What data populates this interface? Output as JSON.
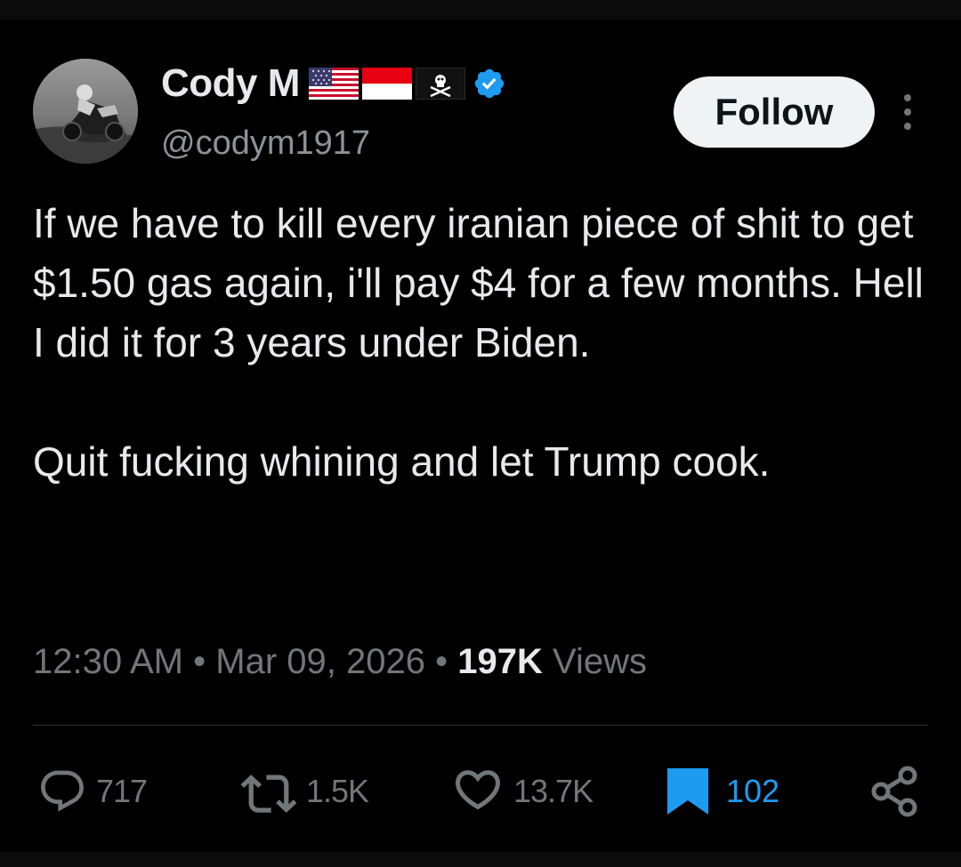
{
  "tweet": {
    "author": {
      "display_name": "Cody M",
      "handle": "@codym1917",
      "flags": [
        "us-flag-icon",
        "indonesia-flag-icon",
        "pirate-flag-icon"
      ],
      "verified_color": "#1d9bf0"
    },
    "follow_label": "Follow",
    "text_paragraphs": [
      "If we have to kill every iranian piece of shit to get $1.50 gas again, i'll pay $4 for a few months. Hell I did it for 3 years under Biden.",
      "Quit fucking whining and let Trump cook."
    ],
    "meta": {
      "time": "12:30 AM",
      "separator": "•",
      "date": "Mar 09, 2026",
      "views_count": "197K",
      "views_label": "Views"
    },
    "actions": {
      "replies": "717",
      "reposts": "1.5K",
      "likes": "13.7K",
      "bookmarks": "102"
    },
    "colors": {
      "background": "#000000",
      "text": "#e7e9ea",
      "muted": "#71767b",
      "accent": "#1d9bf0",
      "follow_bg": "#eff3f4"
    }
  }
}
